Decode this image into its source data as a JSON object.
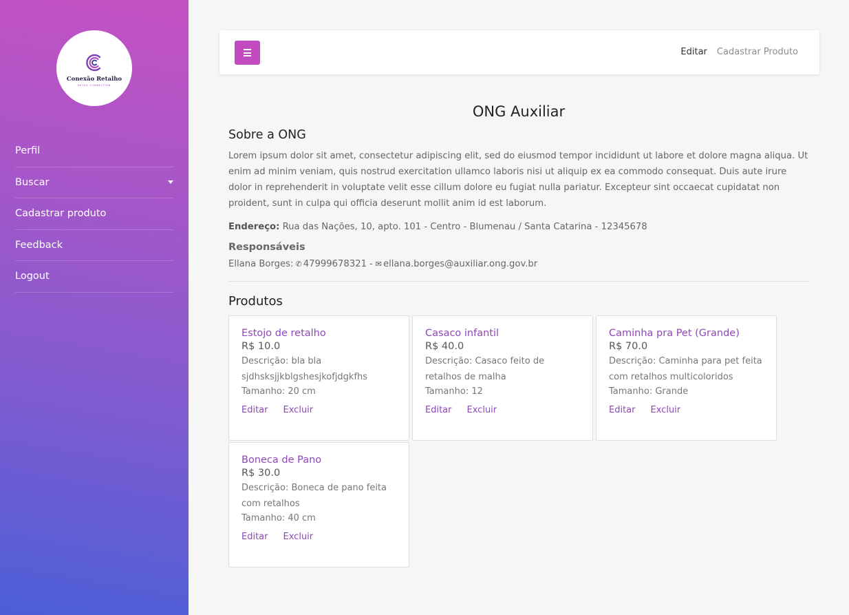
{
  "brand": {
    "logo_text": "Conexão Retalho",
    "logo_subtext": "RETAIL CONNECTION"
  },
  "sidebar": {
    "items": [
      {
        "label": "Perfil"
      },
      {
        "label": "Buscar"
      },
      {
        "label": "Cadastrar produto"
      },
      {
        "label": "Feedback"
      },
      {
        "label": "Logout"
      }
    ]
  },
  "topbar": {
    "links": [
      "Editar",
      "Cadastrar Produto"
    ]
  },
  "org": {
    "name": "ONG Auxiliar",
    "about_title": "Sobre a ONG",
    "about_text": "Lorem ipsum dolor sit amet, consectetur adipiscing elit, sed do eiusmod tempor incididunt ut labore et dolore magna aliqua. Ut enim ad minim veniam, quis nostrud exercitation ullamco laboris nisi ut aliquip ex ea commodo consequat. Duis aute irure dolor in reprehenderit in voluptate velit esse cillum dolore eu fugiat nulla pariatur. Excepteur sint occaecat cupidatat non proident, sunt in culpa qui officia deserunt mollit anim id est laborum.",
    "address_label": "Endereço:",
    "address": "Rua das Nações, 10, apto. 101 - Centro - Blumenau / Santa Catarina - 12345678",
    "responsibles_title": "Responsáveis",
    "responsible": {
      "name": "Ellana Borges:",
      "phone_icon": "phone-icon",
      "phone": "47999678321",
      "separator": "-",
      "email_icon": "envelope-icon",
      "email": "ellana.borges@auxiliar.ong.gov.br"
    }
  },
  "products": {
    "title": "Produtos",
    "edit_label": "Editar",
    "delete_label": "Excluir",
    "items": [
      {
        "name": "Estojo de retalho",
        "price": "R$ 10.0",
        "description": "Descrição: bla bla sjdhsksjjkblgshesjkofjdgkfhs",
        "size": "Tamanho: 20 cm"
      },
      {
        "name": "Casaco infantil",
        "price": "R$ 40.0",
        "description": "Descrição: Casaco feito de retalhos de malha",
        "size": "Tamanho: 12"
      },
      {
        "name": "Caminha pra Pet (Grande)",
        "price": "R$ 70.0",
        "description": "Descrição: Caminha para pet feita com retalhos multicoloridos",
        "size": "Tamanho: Grande"
      },
      {
        "name": "Boneca de Pano",
        "price": "R$ 30.0",
        "description": "Descrição: Boneca de pano feita com retalhos",
        "size": "Tamanho: 40 cm"
      }
    ]
  },
  "colors": {
    "accent": "#c24cbf",
    "link": "#8f47b8",
    "sidebar_top": "#c451c4",
    "sidebar_bottom": "#4b5fd8"
  }
}
